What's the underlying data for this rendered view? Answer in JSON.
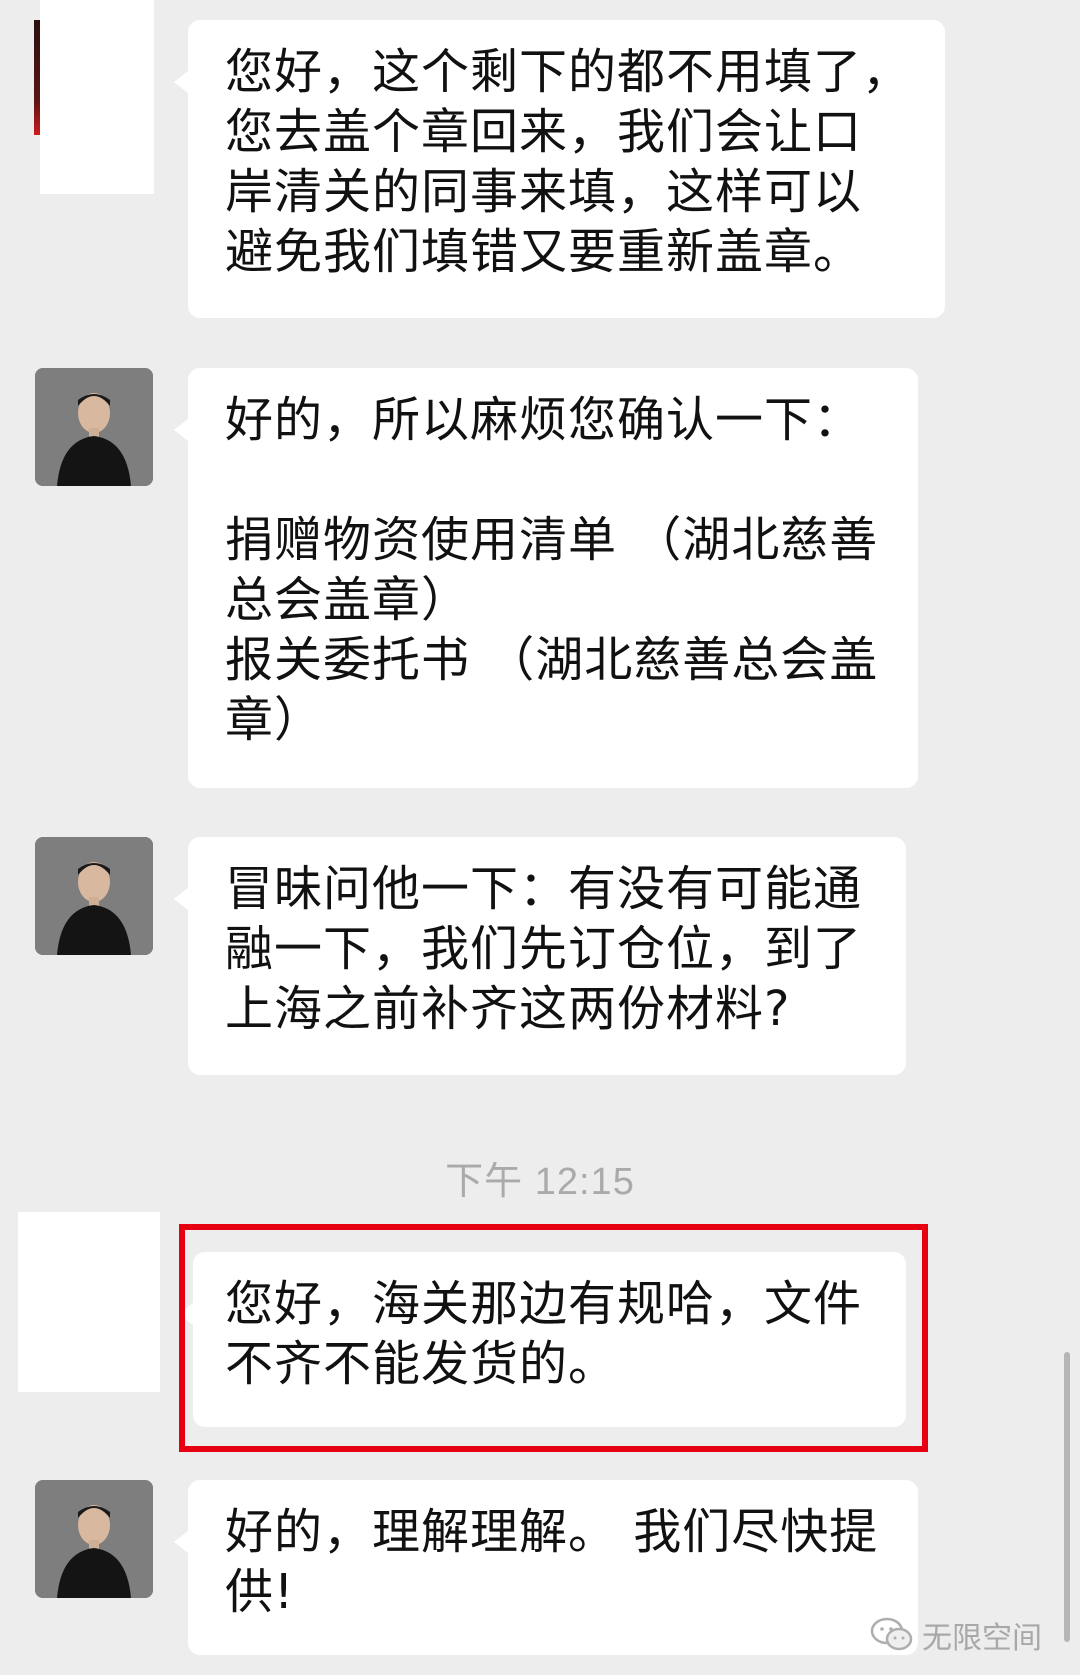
{
  "messages": [
    {
      "sender": "other",
      "text": "您好，这个剩下的都不用填了，\n您去盖个章回来，我们会让口\n岸清关的同事来填，这样可以\n避免我们填错又要重新盖章。"
    },
    {
      "sender": "self",
      "text": "好的，所以麻烦您确认一下：\n\n捐赠物资使用清单 （湖北慈善\n总会盖章）\n报关委托书 （湖北慈善总会盖\n章）"
    },
    {
      "sender": "self",
      "text": "冒昧问他一下：有没有可能通\n融一下，我们先订仓位，到了\n上海之前补齐这两份材料?"
    },
    {
      "sender": "other",
      "text": "您好，海关那边有规哈，文件\n不齐不能发货的。"
    },
    {
      "sender": "self",
      "text": "好的，理解理解。 我们尽快提\n供!"
    }
  ],
  "timestamp": "下午 12:15",
  "watermark": {
    "text": "无限空间",
    "icon": "wechat-icon"
  },
  "colors": {
    "background": "#ededed",
    "bubble": "#ffffff",
    "highlight": "#e60012",
    "timestamp": "#aaaaaa"
  }
}
